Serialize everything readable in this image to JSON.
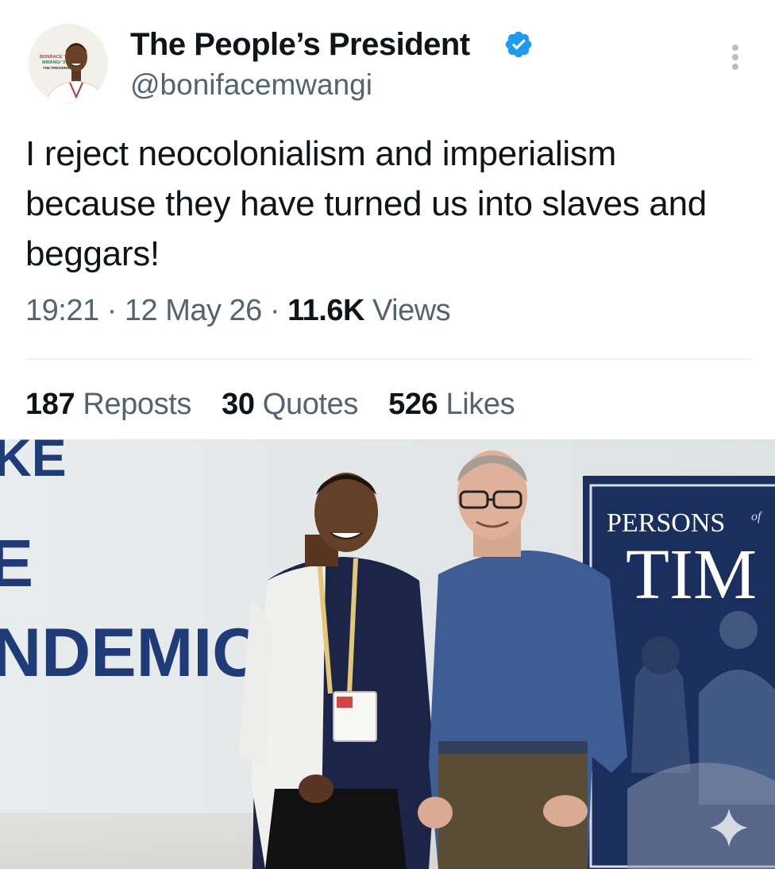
{
  "author": {
    "display_name": "The People’s President",
    "handle": "@bonifacemwangi",
    "verified_icon": "verified-badge-icon",
    "avatar_caption": [
      "BONIFACE ’27",
      "MWANGI ’27",
      "THE PRESIDENT"
    ]
  },
  "tweet": {
    "text": "I reject neocolonialism and imperialism because they have turned us into slaves and beggars!",
    "time": "19:21",
    "date": "12 May 26",
    "views_count": "11.6K",
    "views_label": "Views",
    "separator": "·"
  },
  "stats": {
    "reposts_count": "187",
    "reposts_label": "Reposts",
    "quotes_count": "30",
    "quotes_label": "Quotes",
    "likes_count": "526",
    "likes_label": "Likes"
  },
  "photo": {
    "wall_text": [
      "KE",
      "E",
      "NDEMIC"
    ],
    "poster_text": [
      "PERSONS",
      "of",
      "TIM"
    ]
  },
  "colors": {
    "text_primary": "#0f1419",
    "text_secondary": "#536471",
    "verified_blue": "#1d9bf0",
    "divider": "#eff3f4"
  }
}
